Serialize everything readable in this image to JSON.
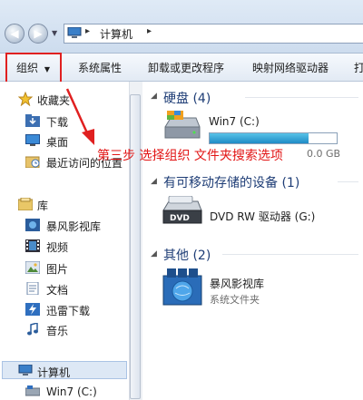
{
  "address": {
    "crumb": "计算机",
    "sep": "▸"
  },
  "toolbar": {
    "organize": "组织",
    "organize_arrow": "▼",
    "system_properties": "系统属性",
    "uninstall": "卸载或更改程序",
    "map_drive": "映射网络驱动器",
    "cut_off": "打"
  },
  "sidebar": {
    "favorites": "收藏夹",
    "downloads": "下载",
    "desktop": "桌面",
    "recent": "最近访问的位置",
    "libraries": "库",
    "lib_items": [
      "暴风影视库",
      "视频",
      "图片",
      "文档",
      "迅雷下载",
      "音乐"
    ],
    "computer": "计算机",
    "win7": "Win7 (C:)"
  },
  "content": {
    "hdd_group": "硬盘 (4)",
    "drive_c_name": "Win7 (C:)",
    "drive_c_fraction": 0.78,
    "drive_c_space": "0.0 GB",
    "removable_group": "有可移动存储的设备 (1)",
    "dvd_label": "DVD RW 驱动器 (G:)",
    "other_group": "其他 (2)",
    "other_name": "暴风影视库",
    "other_sub": "系统文件夹"
  },
  "annotation": {
    "text": "第三步  选择组织  文件夹搜索选项"
  },
  "colors": {
    "accent": "#1e3d76",
    "annotation_red": "#e02020",
    "capacity_fill": "#2a9bd3"
  }
}
